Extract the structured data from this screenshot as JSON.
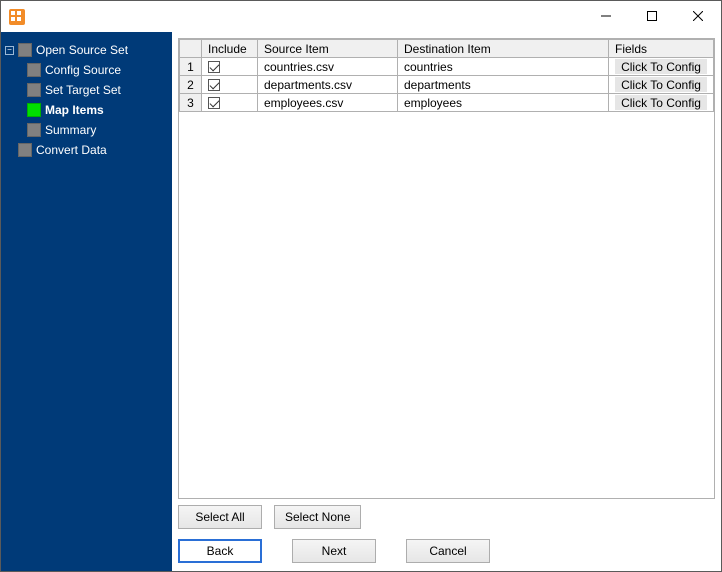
{
  "window": {
    "title": ""
  },
  "sidebar": {
    "items": [
      {
        "label": "Open Source Set",
        "active": false,
        "hasChildren": true
      },
      {
        "label": "Config Source",
        "active": false,
        "child": true
      },
      {
        "label": "Set Target Set",
        "active": false,
        "child": true
      },
      {
        "label": "Map Items",
        "active": true,
        "child": true
      },
      {
        "label": "Summary",
        "active": false,
        "child": true
      },
      {
        "label": "Convert Data",
        "active": false,
        "hasChildren": false
      }
    ]
  },
  "grid": {
    "headers": {
      "rownum": "",
      "include": "Include",
      "source": "Source Item",
      "dest": "Destination Item",
      "fields": "Fields"
    },
    "fields_button_label": "Click To Config",
    "rows": [
      {
        "n": "1",
        "include": true,
        "source": "countries.csv",
        "dest": "countries"
      },
      {
        "n": "2",
        "include": true,
        "source": "departments.csv",
        "dest": "departments"
      },
      {
        "n": "3",
        "include": true,
        "source": "employees.csv",
        "dest": "employees"
      }
    ]
  },
  "buttons": {
    "select_all": "Select All",
    "select_none": "Select None",
    "back": "Back",
    "next": "Next",
    "cancel": "Cancel"
  }
}
